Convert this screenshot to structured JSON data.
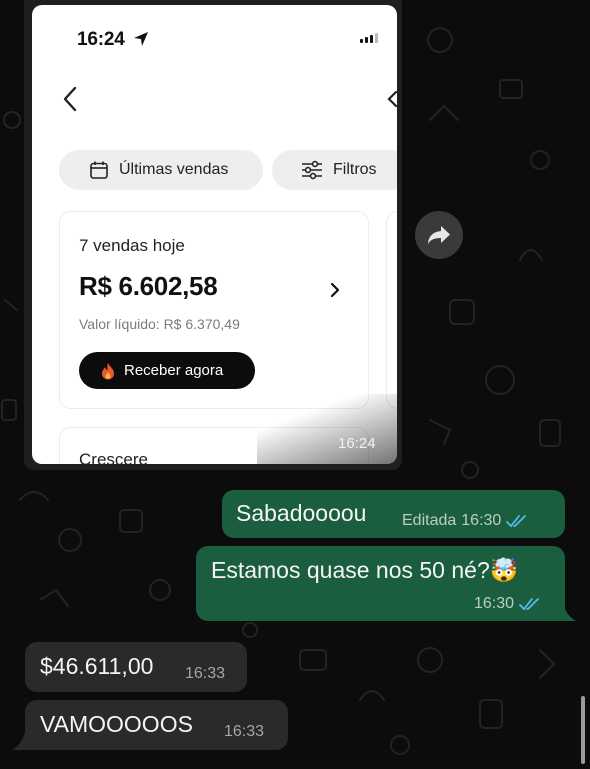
{
  "screenshot": {
    "status_time": "16:24",
    "filter_vendas_label": "Últimas vendas",
    "filter_filtros_label": "Filtros",
    "card": {
      "count_label": "7 vendas hoje",
      "amount": "R$ 6.602,58",
      "net_label": "Valor líquido: R$ 6.370,49",
      "receive_button": "Receber agora"
    },
    "next_card_title": "Crescere",
    "message_time": "16:24"
  },
  "messages": [
    {
      "direction": "out",
      "text": "Sabadoooou",
      "edited_label": "Editada",
      "time": "16:30"
    },
    {
      "direction": "out",
      "text": "Estamos quase nos 50 né?🤯",
      "time": "16:30"
    },
    {
      "direction": "in",
      "text": "$46.611,00",
      "time": "16:33"
    },
    {
      "direction": "in",
      "text": "VAMOOOOOS",
      "time": "16:33"
    }
  ],
  "icons": {
    "forward": "forward-arrow-icon",
    "read_receipt": "double-check-icon",
    "location": "location-arrow-icon",
    "calendar": "calendar-icon",
    "filters": "sliders-icon",
    "fire": "fire-icon"
  },
  "colors": {
    "background": "#0c0c0c",
    "outgoing_bubble": "#1b5e3f",
    "incoming_bubble": "#2a2a2a",
    "read_check": "#53bdeb"
  }
}
